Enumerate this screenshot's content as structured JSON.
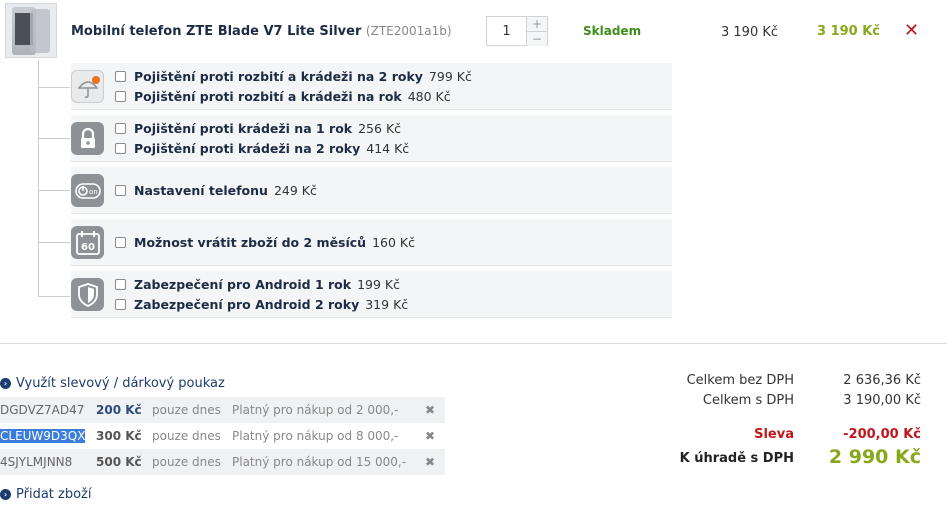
{
  "product": {
    "name": "Mobilní telefon ZTE Blade V7 Lite Silver",
    "code": "(ZTE2001a1b)",
    "quantity": "1",
    "qty_plus": "+",
    "qty_minus": "−",
    "stock": "Skladem",
    "unit_price": "3 190 Kč",
    "total_price": "3 190 Kč",
    "remove": "✕"
  },
  "services": [
    {
      "icon": "insurance-damage-icon",
      "options": [
        {
          "name": "Pojištění proti rozbití a krádeži na 2 roky",
          "price": "799 Kč"
        },
        {
          "name": "Pojištění proti rozbití a krádeži na rok",
          "price": "480 Kč"
        }
      ]
    },
    {
      "icon": "lock-icon",
      "options": [
        {
          "name": "Pojištění proti krádeži na 1 rok",
          "price": "256 Kč"
        },
        {
          "name": "Pojištění proti krádeži na 2 roky",
          "price": "414 Kč"
        }
      ]
    },
    {
      "icon": "phone-setup-icon",
      "options": [
        {
          "name": "Nastavení telefonu",
          "price": "249 Kč"
        }
      ]
    },
    {
      "icon": "calendar-60-icon",
      "icon_text": "60",
      "options": [
        {
          "name": "Možnost vrátit zboží do 2 měsíců",
          "price": "160 Kč"
        }
      ]
    },
    {
      "icon": "shield-icon",
      "options": [
        {
          "name": "Zabezpečení pro Android 1 rok",
          "price": "199 Kč"
        },
        {
          "name": "Zabezpečení pro Android 2 roky",
          "price": "319 Kč"
        }
      ]
    }
  ],
  "voucher_link": "Využít slevový / dárkový poukaz",
  "vouchers": [
    {
      "code": "DGDVZ7AD47",
      "amount": "200 Kč",
      "validity": "pouze dnes",
      "condition": "Platný pro nákup od 2 000,-"
    },
    {
      "code": "CLEUW9D3QX",
      "amount": "300 Kč",
      "validity": "pouze dnes",
      "condition": "Platný pro nákup od 8 000,-"
    },
    {
      "code": "4SJYLMJNN8",
      "amount": "500 Kč",
      "validity": "pouze dnes",
      "condition": "Platný pro nákup od 15 000,-"
    }
  ],
  "voucher_remove": "✖",
  "add_link": "Přidat zboží",
  "summary": {
    "without_vat_label": "Celkem bez DPH",
    "without_vat": "2 636,36 Kč",
    "with_vat_label": "Celkem s DPH",
    "with_vat": "3 190,00 Kč",
    "discount_label": "Sleva",
    "discount": "-200,00 Kč",
    "to_pay_label": "K úhradě s DPH",
    "to_pay": "2 990 Kč"
  },
  "colors": {
    "accent_green": "#87a81b",
    "stock_green": "#3e8e1b",
    "red": "#c0161c",
    "navy": "#1d2c45"
  }
}
